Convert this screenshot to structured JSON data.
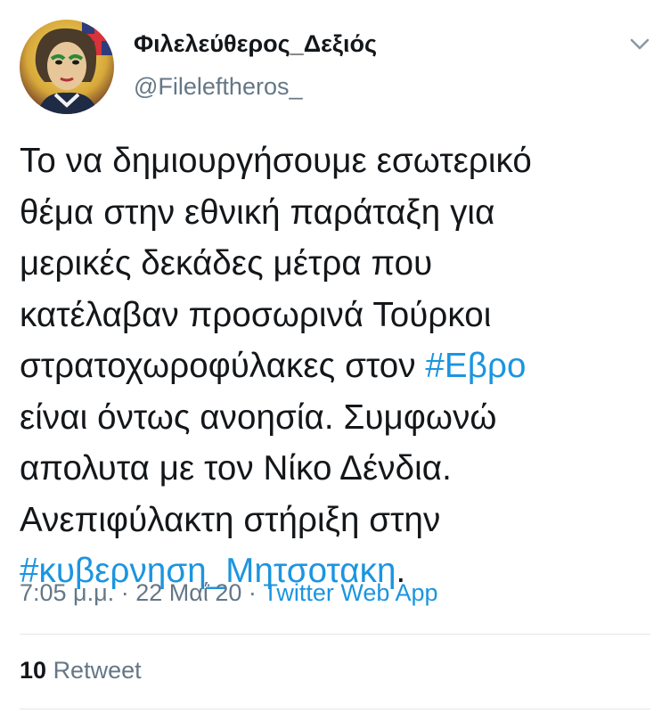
{
  "author": {
    "display_name": "Φιλελεύθερος_Δεξιός",
    "handle": "@Fileleftheros_",
    "avatar_icon": "profile-portrait-avatar"
  },
  "tweet": {
    "lines": [
      [
        "Το να δημιουργήσουμε εσωτερικό"
      ],
      [
        "θέμα στην εθνική παράταξη για"
      ],
      [
        "μερικές δεκάδες μέτρα που"
      ],
      [
        "κατέλαβαν προσωρινά Τούρκοι"
      ],
      [
        "στρατοχωροφύλακες στον ",
        "#Εβρο"
      ],
      [
        "είναι όντως ανοησία. Συμφωνώ"
      ],
      [
        "απολυτα με τον Νίκο Δένδια."
      ],
      [
        "Ανεπιφύλακτη στήριξη στην"
      ],
      [
        "#κυβερνηση_Μητσοτακη",
        "."
      ]
    ],
    "time": "7:05 μ.μ.",
    "separator": "·",
    "date": "22 Μαΐ 20",
    "source": "Twitter Web App"
  },
  "stats": {
    "retweet_count": "10",
    "retweet_label": "Retweet"
  },
  "colors": {
    "text": "#14171a",
    "secondary": "#657786",
    "link": "#1b95e0",
    "divider": "#e1e8ed"
  },
  "icons": {
    "menu": "chevron-down-icon"
  }
}
